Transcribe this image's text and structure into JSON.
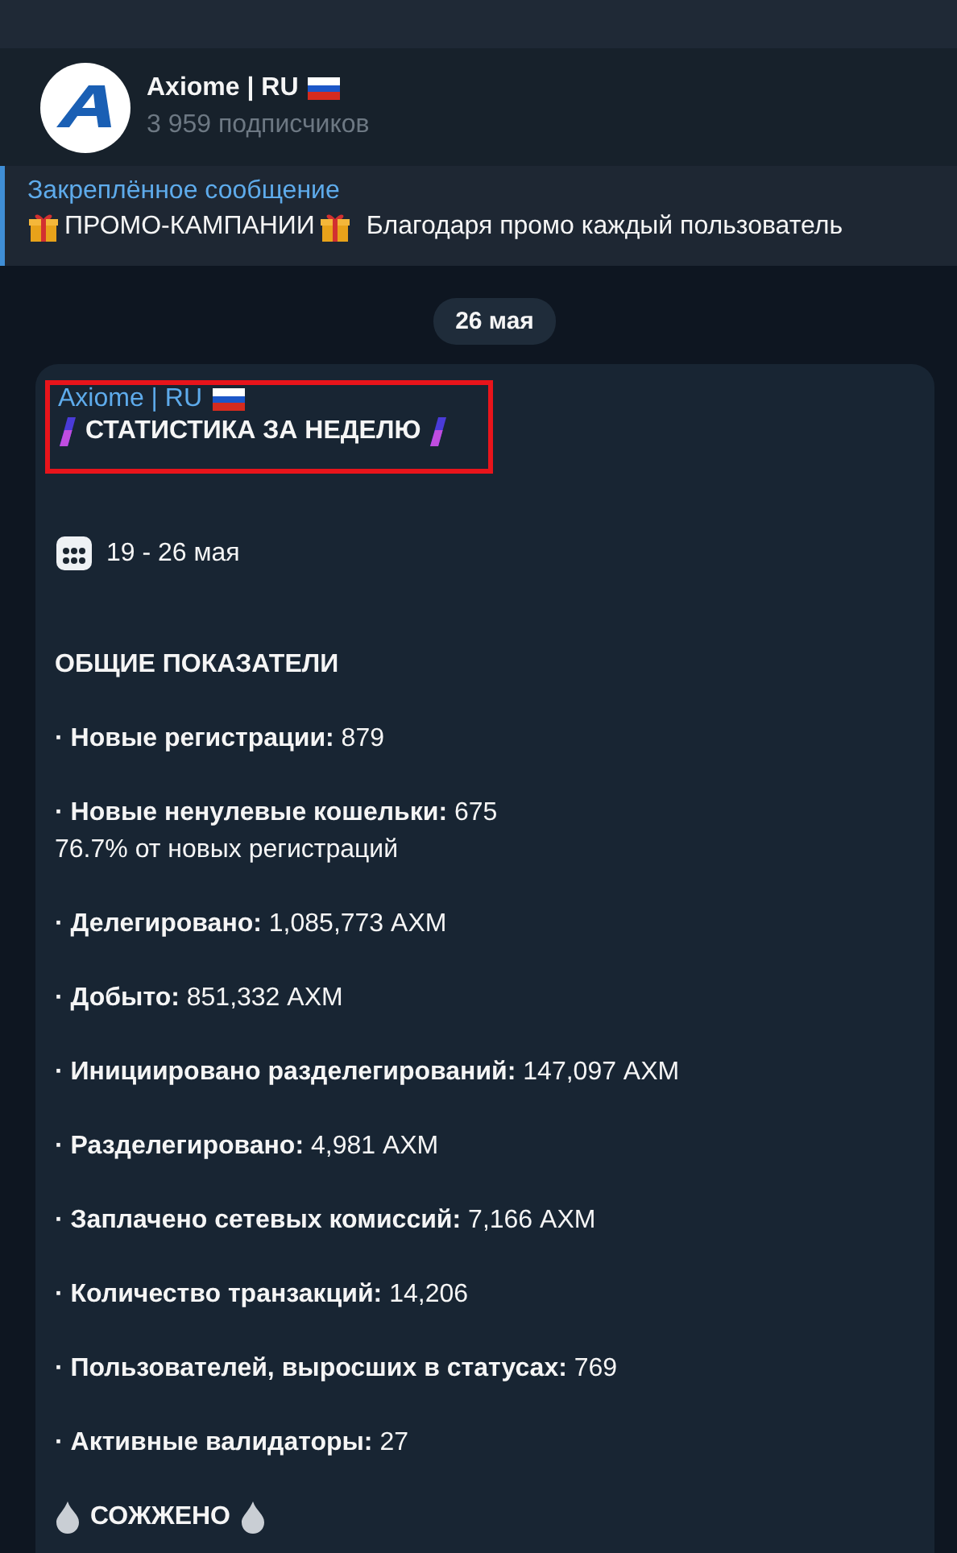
{
  "channel": {
    "name": "Axiome | RU",
    "subscribers": "3 959 подписчиков"
  },
  "pinned": {
    "label": "Закреплённое сообщение",
    "title": "ПРОМО-КАМПАНИИ",
    "text": "Благодаря промо каждый пользователь"
  },
  "date_pill": "26 мая",
  "message": {
    "sender": "Axiome | RU",
    "title": "СТАТИСТИКА ЗА НЕДЕЛЮ",
    "period": "19 - 26 мая",
    "section": "ОБЩИЕ ПОКАЗАТЕЛИ",
    "items": [
      {
        "label": "· Новые регистрации:",
        "value": "879"
      },
      {
        "label": "· Новые ненулевые кошельки:",
        "value": "675",
        "note": "76.7% от новых регистраций"
      },
      {
        "label": "· Делегировано:",
        "value": "1,085,773 AXM"
      },
      {
        "label": "· Добыто:",
        "value": "851,332 AXM"
      },
      {
        "label": "· Инициировано разделегирований:",
        "value": "147,097 AXM"
      },
      {
        "label": "· Разделегировано:",
        "value": "4,981 AXM"
      },
      {
        "label": "· Заплачено сетевых комиссий:",
        "value": "7,166 AXM"
      },
      {
        "label": "· Количество транзакций:",
        "value": "14,206"
      },
      {
        "label": "· Пользователей, выросших в статусах:",
        "value": "769"
      },
      {
        "label": "· Активные валидаторы:",
        "value": "27"
      }
    ],
    "burned": "СОЖЖЕНО"
  }
}
